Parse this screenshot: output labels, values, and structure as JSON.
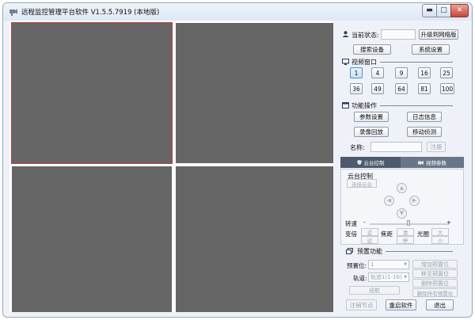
{
  "window": {
    "title": "远程监控管理平台软件 V1.5.5.7919 (本地版)"
  },
  "status": {
    "label": "当前状态:",
    "value": "",
    "upgrade": "升级到网络版"
  },
  "buttons": {
    "search": "搜索设备",
    "settings": "系统设置"
  },
  "video_window": {
    "title": "视频窗口",
    "counts": [
      "1",
      "4",
      "9",
      "16",
      "25",
      "36",
      "49",
      "64",
      "81",
      "100"
    ],
    "active": "1"
  },
  "functions": {
    "title": "功能操作",
    "param": "参数设置",
    "log": "日志信息",
    "record": "录像回放",
    "motion": "移动侦测",
    "name_label": "名称:",
    "register": "注册"
  },
  "tabs": {
    "ptz": "云台控制",
    "video_param": "视频参数"
  },
  "ptz": {
    "title": "云台控制",
    "connect": "连接云台",
    "speed_label": "转速",
    "minus": "-",
    "plus": "+",
    "zoom_label": "变倍",
    "focus_label": "焦距",
    "iris_label": "光圈",
    "near": "近",
    "far": "远",
    "clear": "清",
    "stop": "停",
    "big": "大",
    "small": "小"
  },
  "preset": {
    "title": "预置功能",
    "preset_label": "预置位:",
    "preset_value": "1",
    "add": "增加预置位",
    "goto": "移至预置位",
    "delete": "删除预置位",
    "track_label": "轨道:",
    "track_value": "轨迹1(1-16)",
    "cruise": "巡航",
    "delete_all": "删除所有预置位"
  },
  "footer": {
    "logout": "注销节点",
    "restart": "重启软件",
    "exit": "退出"
  },
  "colors": {
    "pane": "#666666",
    "selected_border": "#c23a3a",
    "window_bg": "#eef2f8",
    "tab_active": "#4d5a6c"
  }
}
